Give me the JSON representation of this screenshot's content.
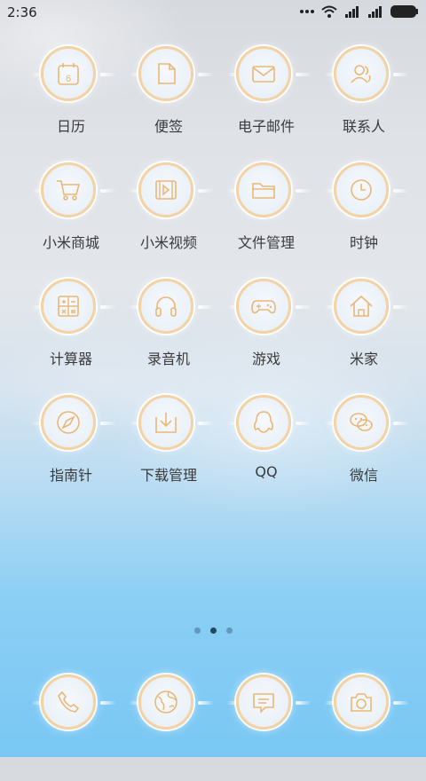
{
  "status_bar": {
    "time": "2:36"
  },
  "apps": [
    {
      "label": "日历",
      "icon": "calendar-icon",
      "day": "6"
    },
    {
      "label": "便签",
      "icon": "note-icon"
    },
    {
      "label": "电子邮件",
      "icon": "mail-icon"
    },
    {
      "label": "联系人",
      "icon": "contacts-icon"
    },
    {
      "label": "小米商城",
      "icon": "cart-icon"
    },
    {
      "label": "小米视频",
      "icon": "video-icon"
    },
    {
      "label": "文件管理",
      "icon": "folder-icon"
    },
    {
      "label": "时钟",
      "icon": "clock-icon"
    },
    {
      "label": "计算器",
      "icon": "calculator-icon"
    },
    {
      "label": "录音机",
      "icon": "headphones-icon"
    },
    {
      "label": "游戏",
      "icon": "gamepad-icon"
    },
    {
      "label": "米家",
      "icon": "home-icon"
    },
    {
      "label": "指南针",
      "icon": "compass-icon"
    },
    {
      "label": "下载管理",
      "icon": "download-icon"
    },
    {
      "label": "QQ",
      "icon": "qq-icon"
    },
    {
      "label": "微信",
      "icon": "wechat-icon"
    }
  ],
  "pagination": {
    "count": 3,
    "active_index": 1
  },
  "dock": [
    {
      "icon": "phone-icon"
    },
    {
      "icon": "browser-icon"
    },
    {
      "icon": "message-icon"
    },
    {
      "icon": "camera-icon"
    }
  ],
  "colors": {
    "icon_stroke": "#e9b777",
    "ring": "#f3d2a4",
    "label": "#3b3b3b"
  }
}
